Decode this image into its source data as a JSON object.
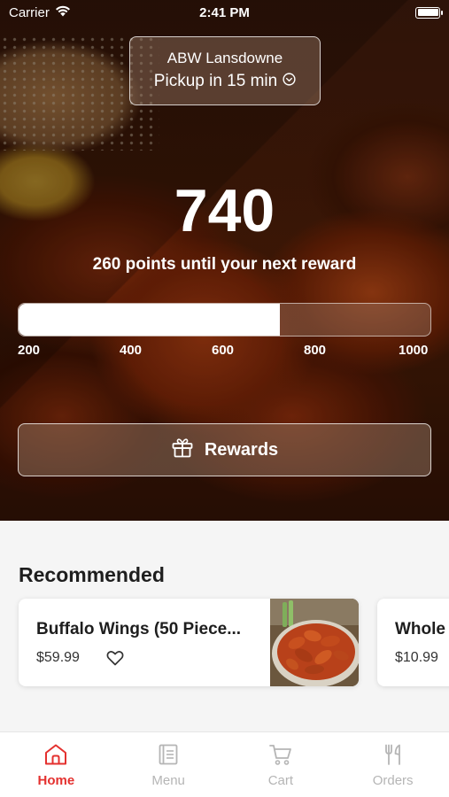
{
  "status_bar": {
    "carrier": "Carrier",
    "time": "2:41 PM"
  },
  "location": {
    "name": "ABW Lansdowne",
    "pickup": "Pickup in 15 min"
  },
  "points": {
    "value": "740",
    "caption": "260 points until your next reward",
    "progress_fraction": 0.635,
    "ticks": [
      "200",
      "400",
      "600",
      "800",
      "1000"
    ]
  },
  "rewards_button": {
    "label": "Rewards"
  },
  "recommended": {
    "title": "Recommended",
    "items": [
      {
        "name": "Buffalo Wings (50 Piece...",
        "price": "$59.99"
      },
      {
        "name": "Whole",
        "price": "$10.99"
      }
    ]
  },
  "tabs": [
    {
      "label": "Home",
      "icon": "home-icon",
      "active": true
    },
    {
      "label": "Menu",
      "icon": "menu-book-icon",
      "active": false
    },
    {
      "label": "Cart",
      "icon": "cart-icon",
      "active": false
    },
    {
      "label": "Orders",
      "icon": "fork-knife-icon",
      "active": false
    }
  ],
  "colors": {
    "accent": "#e4312f",
    "inactive": "#b5b5b5"
  }
}
